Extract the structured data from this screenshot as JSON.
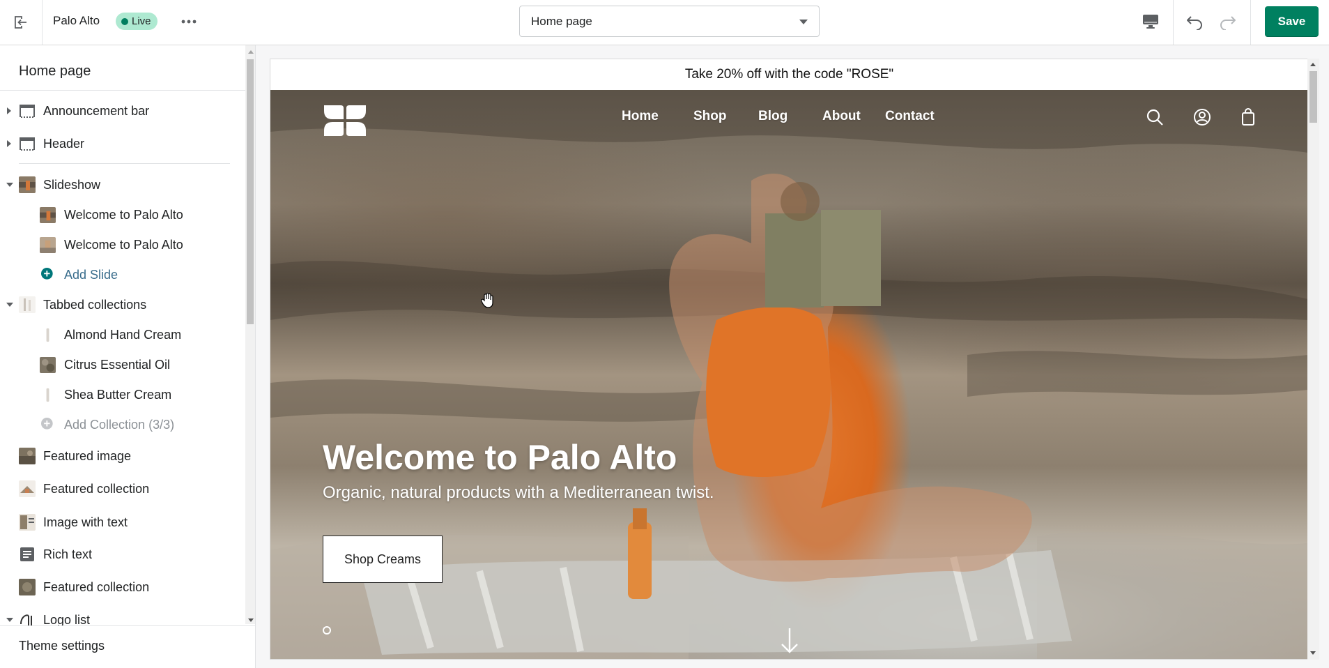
{
  "topbar": {
    "store_name": "Palo Alto",
    "status_badge": "Live",
    "page_selector": "Home page",
    "save_label": "Save",
    "icons": {
      "exit": "exit-icon",
      "more": "more-horizontal-icon",
      "device": "desktop-icon",
      "undo": "undo-icon",
      "redo": "redo-icon"
    }
  },
  "sidebar": {
    "title": "Home page",
    "sections": [
      {
        "label": "Announcement bar",
        "expanded": false
      },
      {
        "label": "Header",
        "expanded": false
      },
      {
        "label": "Slideshow",
        "expanded": true,
        "children": [
          "Welcome to Palo Alto",
          "Welcome to Palo Alto"
        ],
        "add_label": "Add Slide"
      },
      {
        "label": "Tabbed collections",
        "expanded": true,
        "children": [
          "Almond Hand Cream",
          "Citrus Essential Oil",
          "Shea Butter Cream"
        ],
        "add_label": "Add Collection (3/3)"
      },
      {
        "label": "Featured image"
      },
      {
        "label": "Featured collection"
      },
      {
        "label": "Image with text"
      },
      {
        "label": "Rich text"
      },
      {
        "label": "Featured collection"
      },
      {
        "label": "Logo list",
        "expanded": true
      }
    ],
    "footer": "Theme settings"
  },
  "preview": {
    "announcement": "Take 20% off with the code \"ROSE\"",
    "nav": [
      "Home",
      "Shop",
      "Blog",
      "About",
      "Contact"
    ],
    "hero_title": "Welcome to Palo Alto",
    "hero_subtitle": "Organic, natural products with a Mediterranean twist.",
    "hero_button": "Shop Creams"
  },
  "colors": {
    "accent": "#008060",
    "live_badge_bg": "#aee9d1",
    "link": "#2c6ecb"
  }
}
